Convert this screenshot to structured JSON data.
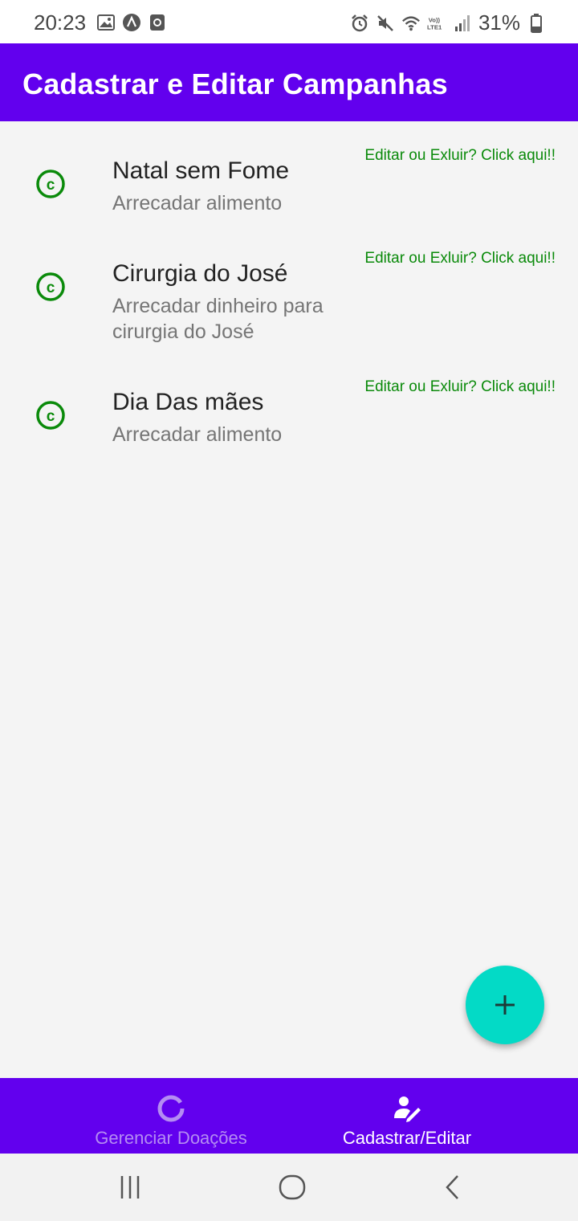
{
  "status_bar": {
    "time": "20:23",
    "battery_percent": "31%",
    "left_icons": [
      "gallery-icon",
      "app-icon",
      "notification-icon"
    ],
    "right_icons": [
      "alarm-icon",
      "mute-icon",
      "wifi-icon",
      "volte-icon",
      "signal-icon",
      "battery-icon"
    ]
  },
  "app_bar": {
    "title": "Cadastrar e Editar Campanhas"
  },
  "campaigns": [
    {
      "title": "Natal sem Fome",
      "description": "Arrecadar alimento",
      "action": "Editar ou Exluir? Click aqui!!"
    },
    {
      "title": "Cirurgia do José",
      "description": "Arrecadar dinheiro para cirurgia do José",
      "action": "Editar ou Exluir? Click aqui!!"
    },
    {
      "title": "Dia Das mães",
      "description": "Arrecadar alimento",
      "action": "Editar ou Exluir? Click aqui!!"
    }
  ],
  "fab": {
    "icon": "plus-icon"
  },
  "bottom_nav": {
    "items": [
      {
        "label": "Gerenciar Doações",
        "icon": "donut-icon",
        "active": false
      },
      {
        "label": "Cadastrar/Editar",
        "icon": "user-edit-icon",
        "active": true
      }
    ]
  },
  "colors": {
    "primary": "#6200ee",
    "accent": "#03dac6",
    "action_text": "#0a8a0a",
    "background": "#f4f4f4"
  }
}
